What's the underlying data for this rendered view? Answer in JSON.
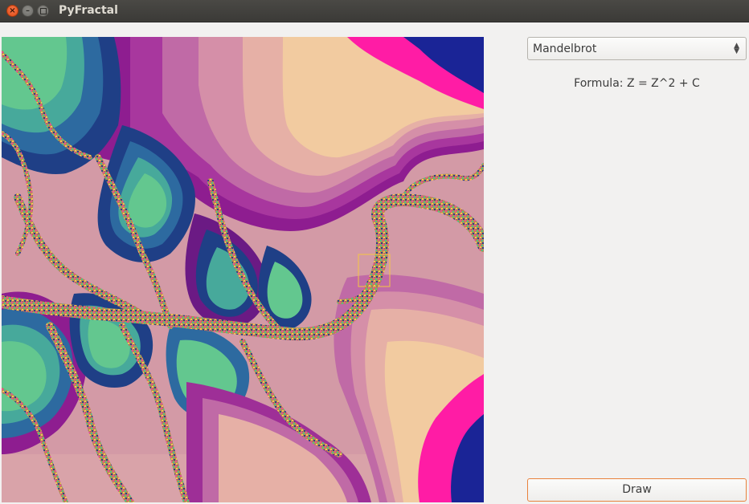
{
  "window": {
    "title": "PyFractal"
  },
  "controls": {
    "fractal_select": {
      "value": "Mandelbrot"
    },
    "formula_text": "Formula: Z = Z^2 + C",
    "draw_label": "Draw"
  },
  "canvas": {
    "icon": "mandelbrot-fractal-render"
  },
  "colors": {
    "titlebar": "#3c3b37",
    "close_button": "#e95420",
    "draw_button_border": "#e9823c",
    "selection_rectangle": "#f5c542"
  }
}
